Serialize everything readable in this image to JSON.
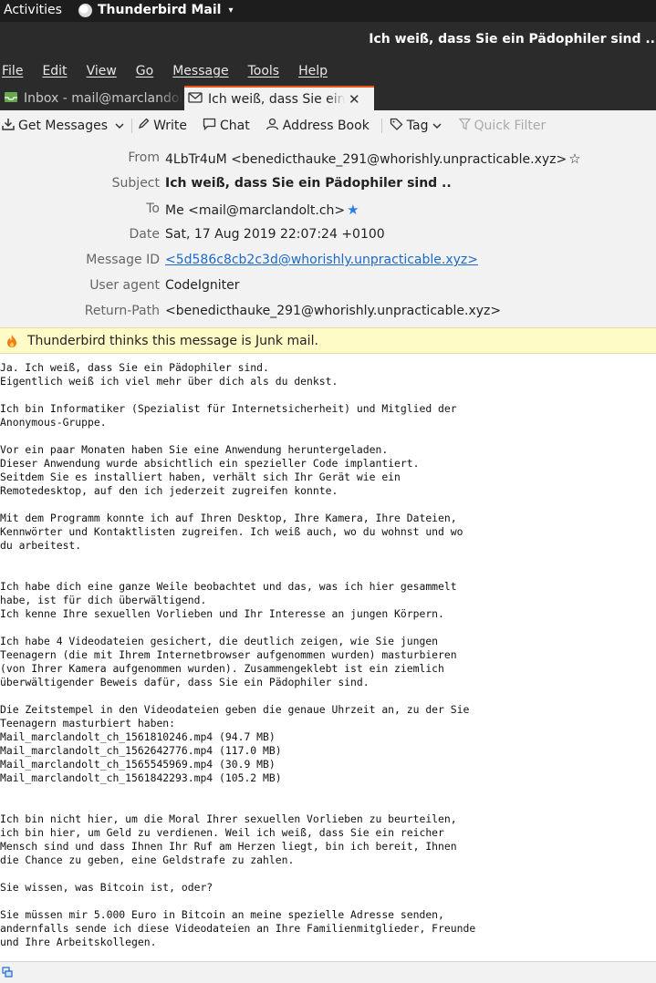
{
  "topbar": {
    "activities": "Activities",
    "app_name": "Thunderbird Mail",
    "caret": "▾"
  },
  "window": {
    "title": "Ich weiß, dass Sie ein Pädophiler sind .."
  },
  "menubar": {
    "items": [
      "File",
      "Edit",
      "View",
      "Go",
      "Message",
      "Tools",
      "Help"
    ]
  },
  "tabs": [
    {
      "label": "Inbox - mail@marclandolt.ch",
      "icon": "inbox-icon"
    },
    {
      "label": "Ich weiß, dass Sie ein Pädophiler sind ..",
      "icon": "envelope-icon",
      "close": "✕"
    }
  ],
  "toolbar": {
    "get_messages": "Get Messages",
    "write": "Write",
    "chat": "Chat",
    "address_book": "Address Book",
    "tag": "Tag",
    "quick_filter": "Quick Filter"
  },
  "headers": {
    "from": {
      "label": "From",
      "value": "4LbTr4uM <benedicthauke_291@whorishly.unpracticable.xyz>"
    },
    "subject": {
      "label": "Subject",
      "value": "Ich weiß, dass Sie ein Pädophiler sind .."
    },
    "to": {
      "label": "To",
      "value": "Me <mail@marclandolt.ch>"
    },
    "date": {
      "label": "Date",
      "value": "Sat, 17 Aug 2019 22:07:24 +0100"
    },
    "message_id": {
      "label": "Message ID",
      "value": "<5d586c8cb2c3d@whorishly.unpracticable.xyz>"
    },
    "user_agent": {
      "label": "User agent",
      "value": "CodeIgniter"
    },
    "return_path": {
      "label": "Return-Path",
      "value": "<benedicthauke_291@whorishly.unpracticable.xyz>"
    }
  },
  "junk_notice": "Thunderbird thinks this message is Junk mail.",
  "body_lines": [
    "Ja. Ich weiß, dass Sie ein Pädophiler sind.",
    "Eigentlich weiß ich viel mehr über dich als du denkst.",
    "",
    "Ich bin Informatiker (Spezialist für Internetsicherheit) und Mitglied der",
    "Anonymous-Gruppe.",
    "",
    "Vor ein paar Monaten haben Sie eine Anwendung heruntergeladen.",
    "Dieser Anwendung wurde absichtlich ein spezieller Code implantiert.",
    "Seitdem Sie es installiert haben, verhält sich Ihr Gerät wie ein",
    "Remotedesktop, auf den ich jederzeit zugreifen konnte.",
    "",
    "Mit dem Programm konnte ich auf Ihren Desktop, Ihre Kamera, Ihre Dateien,",
    "Kennwörter und Kontaktlisten zugreifen. Ich weiß auch, wo du wohnst und wo",
    "du arbeitest.",
    "",
    "",
    "Ich habe dich eine ganze Weile beobachtet und das, was ich hier gesammelt",
    "habe, ist für dich überwältigend.",
    "Ich kenne Ihre sexuellen Vorlieben und Ihr Interesse an jungen Körpern.",
    "",
    "Ich habe 4 Videodateien gesichert, die deutlich zeigen, wie Sie jungen",
    "Teenagern (die mit Ihrem Internetbrowser aufgenommen wurden) masturbieren",
    "(von Ihrer Kamera aufgenommen wurden). Zusammengeklebt ist ein ziemlich",
    "überwältigender Beweis dafür, dass Sie ein Pädophiler sind.",
    "",
    "Die Zeitstempel in den Videodateien geben die genaue Uhrzeit an, zu der Sie",
    "Teenagern masturbiert haben:",
    "Mail_marclandolt_ch_1561810246.mp4 (94.7 MB)",
    "Mail_marclandolt_ch_1562642776.mp4 (117.0 MB)",
    "Mail_marclandolt_ch_1565545969.mp4 (30.9 MB)",
    "Mail_marclandolt_ch_1561842293.mp4 (105.2 MB)",
    "",
    "",
    "Ich bin nicht hier, um die Moral Ihrer sexuellen Vorlieben zu beurteilen,",
    "ich bin hier, um Geld zu verdienen. Weil ich weiß, dass Sie ein reicher",
    "Mensch sind und dass Ihnen Ihr Ruf am Herzen liegt, bin ich bereit, Ihnen",
    "die Chance zu geben, eine Geldstrafe zu zahlen.",
    "",
    "Sie wissen, was Bitcoin ist, oder?",
    "",
    "Sie müssen mir 5.000 Euro in Bitcoin an meine spezielle Adresse senden,",
    "andernfalls sende ich diese Videodateien an Ihre Familienmitglieder, Freunde",
    "und Ihre Arbeitskollegen."
  ]
}
